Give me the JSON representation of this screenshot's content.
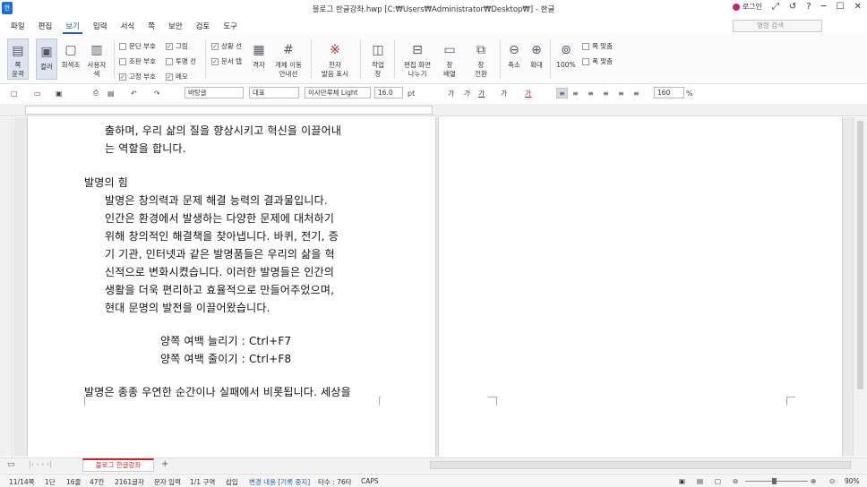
{
  "title_bar": {
    "app_icon_text": "한",
    "title": "블로그 한글강좌.hwp [C:₩Users₩Administrator₩Desktop₩] - 한글",
    "login_label": "로그인"
  },
  "menu": {
    "items": [
      "파일",
      "편집",
      "보기",
      "입력",
      "서식",
      "쪽",
      "보안",
      "검토",
      "도구"
    ],
    "active": "보기",
    "search_placeholder": "명령 검색"
  },
  "ribbon": {
    "page_outline": "쪽\n윤곽",
    "color": "컬러",
    "gray": "회색조",
    "user_color": "사용자\n색",
    "checks": {
      "para_mark": "문단 부호",
      "picture": "그림",
      "control_mark": "조판 부호",
      "transparent_line": "투명 선",
      "fixed_mark": "고정 부호",
      "memo": "메모",
      "status_line": "상황 선",
      "doc_tab": "문서 탭"
    },
    "grid": "격자",
    "object_move_guide": "개체 이동\n안내선",
    "hanja_reading": "한자\n발음 표시",
    "work_window": "작업\n창",
    "edit_screen_split": "편집 화면\n나누기",
    "window_arrange": "창\n배열",
    "new_window": "창\n전환",
    "zoom_out": "축소",
    "zoom_in": "확대",
    "zoom_100": "100%",
    "fit_page": "쪽 맞춤",
    "fit_width": "폭 맞춤"
  },
  "format_bar": {
    "style": "바탕글",
    "font_lang": "대표",
    "font_name": "이사만루체 Light",
    "font_size": "16.0",
    "size_unit": "pt",
    "line_spacing": "160",
    "line_unit": "%"
  },
  "document": {
    "lines": [
      "출하며, 우리 삶의 질을 향상시키고 혁신을 이끌어내",
      "는 역할을 합니다.",
      "발명의 힘",
      "발명은 창의력과 문제 해결 능력의 결과물입니다.",
      "인간은 환경에서 발생하는 다양한 문제에 대처하기",
      "위해 창의적인 해결책을 찾아냅니다. 바퀴, 전기, 증",
      "기 기관, 인터넷과 같은 발명품들은 우리의 삶을 혁",
      "신적으로 변화시켰습니다. 이러한 발명들은 인간의",
      "생활을 더욱 편리하고 효율적으로 만들어주었으며,",
      "현대 문명의 발전을 이끌어왔습니다.",
      "양쪽 여백 늘리기 : Ctrl+F7",
      "양쪽 여백 줄이기 : Ctrl+F8",
      "발명은 종종 우연한 순간이나 실패에서 비롯됩니다. 세상을"
    ]
  },
  "tab_bar": {
    "doc_tab": "블로그 한글강좌",
    "add": "+"
  },
  "status_bar": {
    "page": "11/14쪽",
    "section": "1단",
    "line": "16줄",
    "column": "47칸",
    "chars": "2161글자",
    "input_mode": "문자 입력",
    "area": "1/1 구역",
    "insert": "삽입",
    "track": "변경 내용 [기록 중지]",
    "word_count": "타수 : 76타",
    "caps": "CAPS",
    "zoom": "90%"
  }
}
